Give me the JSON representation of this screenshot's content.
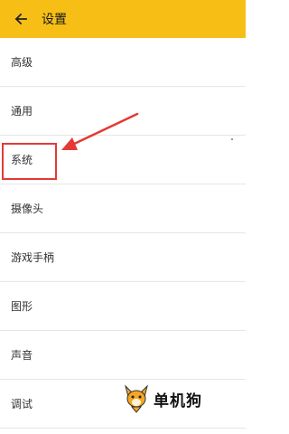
{
  "header": {
    "title": "设置"
  },
  "menu": {
    "items": [
      {
        "label": "高级"
      },
      {
        "label": "通用"
      },
      {
        "label": "系统"
      },
      {
        "label": "摄像头"
      },
      {
        "label": "游戏手柄"
      },
      {
        "label": "图形"
      },
      {
        "label": "声音"
      },
      {
        "label": "调试"
      }
    ]
  },
  "watermark": {
    "text": "单机狗"
  },
  "colors": {
    "appbar": "#f7bf16",
    "highlight": "#e53935"
  }
}
